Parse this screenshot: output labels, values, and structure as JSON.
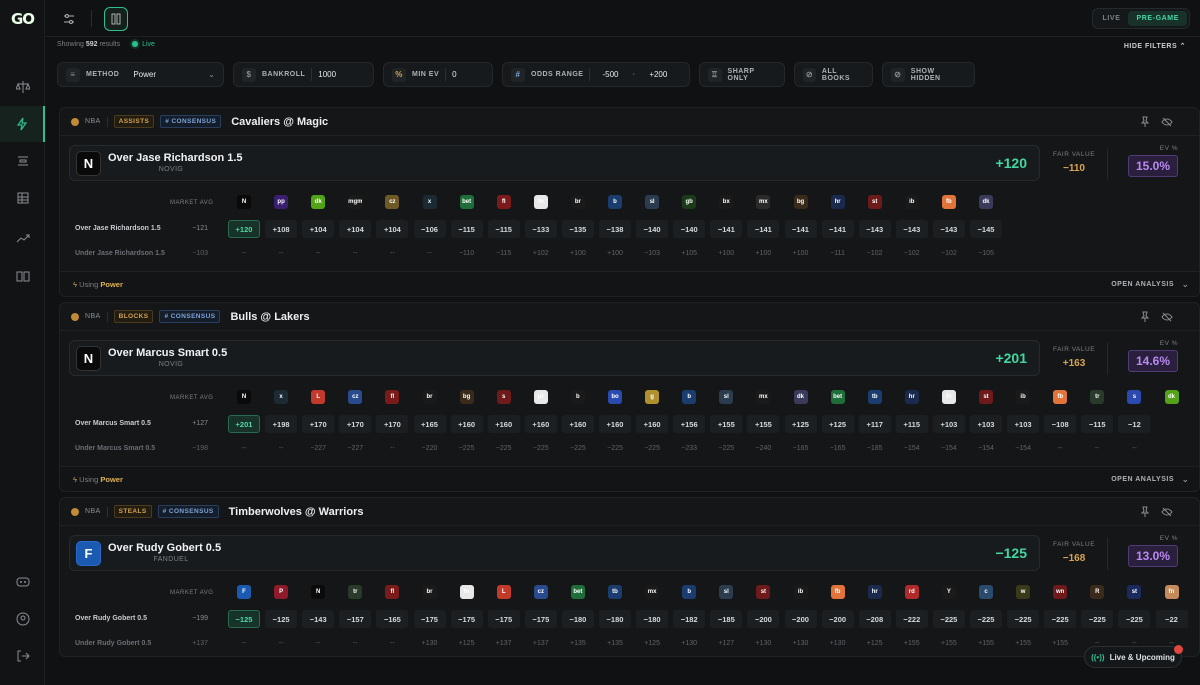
{
  "app": {
    "logo": "GO"
  },
  "topbar": {
    "seg_live": "LIVE",
    "seg_pregame": "PRE-GAME"
  },
  "meta": {
    "showing_prefix": "Showing",
    "count": "592",
    "showing_suffix": "results",
    "live_label": "Live",
    "hide_filters": "HIDE FILTERS"
  },
  "filters": {
    "method_label": "METHOD",
    "method_value": "Power",
    "bankroll_label": "BANKROLL",
    "bankroll_value": "1000",
    "minev_label": "MIN EV",
    "minev_value": "0",
    "odds_label": "ODDS RANGE",
    "odds_min": "-500",
    "odds_dash": "-",
    "odds_max": "+200",
    "sharp": "SHARP ONLY",
    "allbooks": "ALL BOOKS",
    "hidden": "SHOW HIDDEN"
  },
  "labels": {
    "market_avg": "MARKET AVG",
    "fair_value": "FAIR VALUE",
    "ev_pct": "EV %",
    "using": "Using",
    "open_analysis": "OPEN ANALYSIS",
    "live_upcoming": "Live & Upcoming"
  },
  "cards": [
    {
      "league": "NBA",
      "market": "ASSISTS",
      "consensus": "CONSENSUS",
      "game": "Cavaliers @ Magic",
      "pick": "Over Jase Richardson 1.5",
      "book": "NOVIG",
      "pick_logo": "N",
      "pick_odds": "+120",
      "fair": "−110",
      "ev": "15.0%",
      "over_label": "Over Jase Richardson 1.5",
      "over_avg": "−121",
      "under_label": "Under Jase Richardson 1.5",
      "under_avg": "−103",
      "method": "Power",
      "books": [
        [
          "N",
          "#0a0a0a"
        ],
        [
          "pp",
          "#3a1f6e"
        ],
        [
          "dk",
          "#53a318"
        ],
        [
          "mgm",
          "#1a1a1a"
        ],
        [
          "cz",
          "#6e5a26"
        ],
        [
          "x",
          "#1b2a33"
        ],
        [
          "bet",
          "#1f6e3a"
        ],
        [
          "fl",
          "#7a1a1a"
        ],
        [
          "fn",
          "#e8e8e8"
        ],
        [
          "br",
          "#1a1a1a"
        ],
        [
          "b",
          "#1a3c6e"
        ],
        [
          "sl",
          "#2a3c4e"
        ],
        [
          "gb",
          "#1a3a1a"
        ],
        [
          "bx",
          "#1a1a1a"
        ],
        [
          "mx",
          "#2a2a2a"
        ],
        [
          "bg",
          "#3a2a1a"
        ],
        [
          "hr",
          "#1a2a4e"
        ],
        [
          "st",
          "#6e1a1a"
        ],
        [
          "ib",
          "#1a1a1a"
        ],
        [
          "fb",
          "#e0743a"
        ],
        [
          "dk",
          "#3a3a5a"
        ]
      ],
      "over": [
        "+120",
        "+108",
        "+104",
        "+104",
        "+104",
        "−106",
        "−115",
        "−115",
        "−133",
        "−135",
        "−138",
        "−140",
        "−140",
        "−141",
        "−141",
        "−141",
        "−141",
        "−143",
        "−143",
        "−143",
        "−145"
      ],
      "under": [
        "--",
        "--",
        "--",
        "--",
        "--",
        "--",
        "−110",
        "−115",
        "+102",
        "+100",
        "+100",
        "−103",
        "+105",
        "+100",
        "+100",
        "+100",
        "−111",
        "−102",
        "−102",
        "−102",
        "−105"
      ]
    },
    {
      "league": "NBA",
      "market": "BLOCKS",
      "consensus": "CONSENSUS",
      "game": "Bulls @ Lakers",
      "pick": "Over Marcus Smart 0.5",
      "book": "NOVIG",
      "pick_logo": "N",
      "pick_odds": "+201",
      "fair": "+163",
      "ev": "14.6%",
      "over_label": "Over Marcus Smart 0.5",
      "over_avg": "+127",
      "under_label": "Under Marcus Smart 0.5",
      "under_avg": "−198",
      "method": "Power",
      "books": [
        [
          "N",
          "#0a0a0a"
        ],
        [
          "x",
          "#1b2a33"
        ],
        [
          "L",
          "#c43a2a"
        ],
        [
          "cz",
          "#2a4a8e"
        ],
        [
          "fl",
          "#7a1a1a"
        ],
        [
          "br",
          "#1a1a1a"
        ],
        [
          "bg",
          "#3a2a1a"
        ],
        [
          "s",
          "#6e1a1a"
        ],
        [
          "pr",
          "#e8e8e8"
        ],
        [
          "b",
          "#1a1a1a"
        ],
        [
          "bo",
          "#2a4ab0"
        ],
        [
          "g",
          "#b0902a"
        ],
        [
          "b",
          "#1a3c6e"
        ],
        [
          "sl",
          "#2a3c4e"
        ],
        [
          "mx",
          "#1a1a1a"
        ],
        [
          "dk",
          "#3a3a5a"
        ],
        [
          "bet",
          "#1f6e3a"
        ],
        [
          "tb",
          "#1a3c6e"
        ],
        [
          "hr",
          "#1a2a4e"
        ],
        [
          "fn",
          "#e8e8e8"
        ],
        [
          "st",
          "#6e1a1a"
        ],
        [
          "ib",
          "#1a1a1a"
        ],
        [
          "fb",
          "#e0743a"
        ],
        [
          "tr",
          "#2a3a2a"
        ],
        [
          "s",
          "#2a4ab0"
        ],
        [
          "dk",
          "#53a318"
        ]
      ],
      "over": [
        "+201",
        "+198",
        "+170",
        "+170",
        "+170",
        "+165",
        "+160",
        "+160",
        "+160",
        "+160",
        "+160",
        "+160",
        "+156",
        "+155",
        "+155",
        "+125",
        "+125",
        "+117",
        "+115",
        "+103",
        "+103",
        "+103",
        "−108",
        "−115",
        "−12"
      ],
      "under": [
        "--",
        "--",
        "−227",
        "−227",
        "--",
        "−220",
        "−225",
        "−225",
        "−225",
        "−225",
        "−225",
        "−225",
        "−233",
        "−225",
        "−240",
        "−165",
        "−165",
        "−185",
        "−154",
        "−154",
        "−154",
        "−154",
        "--",
        "--",
        "--"
      ]
    },
    {
      "league": "NBA",
      "market": "STEALS",
      "consensus": "CONSENSUS",
      "game": "Timberwolves @ Warriors",
      "pick": "Over Rudy Gobert 0.5",
      "book": "FANDUEL",
      "pick_logo": "F",
      "pick_odds": "−125",
      "fair": "−168",
      "ev": "13.0%",
      "over_label": "Over Rudy Gobert 0.5",
      "over_avg": "−199",
      "under_label": "Under Rudy Gobert 0.5",
      "under_avg": "+137",
      "method": "Power",
      "books": [
        [
          "F",
          "#1a5ab0"
        ],
        [
          "P",
          "#8e1a2a"
        ],
        [
          "N",
          "#0a0a0a"
        ],
        [
          "tr",
          "#2a3a2a"
        ],
        [
          "fl",
          "#7a1a1a"
        ],
        [
          "br",
          "#1a1a1a"
        ],
        [
          "fn",
          "#e8e8e8"
        ],
        [
          "L",
          "#c43a2a"
        ],
        [
          "cz",
          "#2a4a8e"
        ],
        [
          "bet",
          "#1f6e3a"
        ],
        [
          "tb",
          "#1a3c6e"
        ],
        [
          "mx",
          "#1a1a1a"
        ],
        [
          "b",
          "#1a3c6e"
        ],
        [
          "sl",
          "#2a3c4e"
        ],
        [
          "st",
          "#6e1a1a"
        ],
        [
          "ib",
          "#1a1a1a"
        ],
        [
          "fb",
          "#e0743a"
        ],
        [
          "hr",
          "#1a2a4e"
        ],
        [
          "rd",
          "#b02a2a"
        ],
        [
          "Y",
          "#1a1a1a"
        ],
        [
          "c",
          "#2a4a6e"
        ],
        [
          "w",
          "#3a3a1a"
        ],
        [
          "wn",
          "#6e1a1a"
        ],
        [
          "R",
          "#3a2a1a"
        ],
        [
          "st",
          "#1a2a5e"
        ],
        [
          "fn",
          "#c48a5a"
        ]
      ],
      "over": [
        "−125",
        "−125",
        "−143",
        "−157",
        "−165",
        "−175",
        "−175",
        "−175",
        "−175",
        "−180",
        "−180",
        "−180",
        "−182",
        "−185",
        "−200",
        "−200",
        "−200",
        "−208",
        "−222",
        "−225",
        "−225",
        "−225",
        "−225",
        "−225",
        "−225",
        "−22"
      ],
      "under": [
        "--",
        "--",
        "--",
        "--",
        "--",
        "+130",
        "+125",
        "+137",
        "+137",
        "+135",
        "+135",
        "+125",
        "+130",
        "+127",
        "+130",
        "+130",
        "+130",
        "+125",
        "+155",
        "+155",
        "+155",
        "+155",
        "+155",
        "--",
        "--",
        "--"
      ]
    }
  ]
}
